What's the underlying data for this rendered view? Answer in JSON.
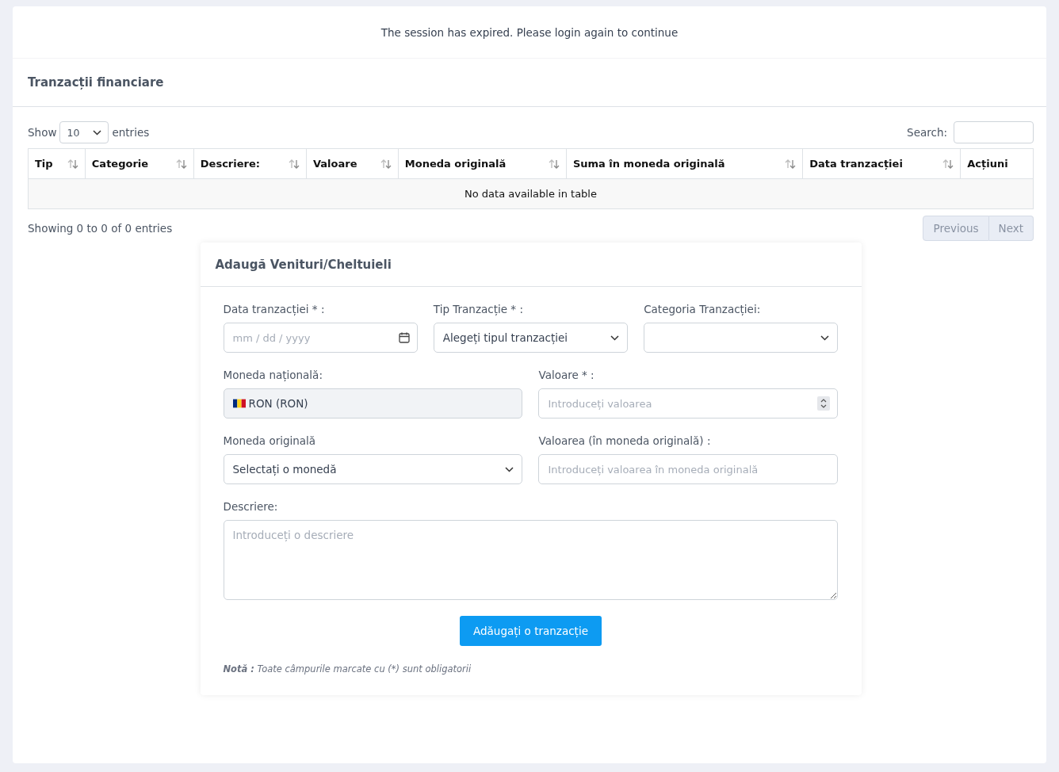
{
  "alert": {
    "text": "The session has expired. Please login again to continue"
  },
  "panel": {
    "title": "Tranzacții financiare"
  },
  "table_controls": {
    "show_label": "Show",
    "page_size": "10",
    "entries_label": "entries",
    "search_label": "Search:"
  },
  "table": {
    "columns": [
      {
        "label": "Tip",
        "sortable": true
      },
      {
        "label": "Categorie",
        "sortable": true
      },
      {
        "label": "Descriere:",
        "sortable": true
      },
      {
        "label": "Valoare",
        "sortable": true
      },
      {
        "label": "Moneda originală",
        "sortable": true
      },
      {
        "label": "Suma în moneda originală",
        "sortable": true
      },
      {
        "label": "Data tranzacției",
        "sortable": true
      },
      {
        "label": "Acțiuni",
        "sortable": false
      }
    ],
    "empty_message": "No data available in table"
  },
  "table_info": "Showing 0 to 0 of 0 entries",
  "pagination": [
    {
      "label": "Previous",
      "disabled": true
    },
    {
      "label": "Next",
      "disabled": true
    }
  ],
  "form": {
    "title": "Adaugă Venituri/Cheltuieli",
    "fields": [
      {
        "kind": "date",
        "label": "Data tranzacției * :",
        "placeholder": "mm / dd / yyyy"
      },
      {
        "kind": "select",
        "label": "Tip Tranzacție * :",
        "value": "Alegeți tipul tranzacției"
      },
      {
        "kind": "select",
        "label": "Categoria Tranzacției:"
      },
      {
        "kind": "readonly",
        "label": "Moneda națională:",
        "value": "RON (RON)"
      },
      {
        "kind": "number",
        "label": "Valoare * :",
        "placeholder": "Introduceți valoarea"
      },
      {
        "kind": "select",
        "label": "Moneda originală",
        "value": "Selectați o monedă"
      },
      {
        "kind": "text",
        "label": "Valoarea (în moneda originală) :",
        "placeholder": "Introduceți valoarea în moneda originală"
      },
      {
        "kind": "textarea",
        "label": "Descriere:",
        "placeholder": "Introduceți o descriere"
      }
    ],
    "submit": "Adăugați o tranzacție",
    "note": "**Notă :** Toate câmpurile marcate cu (*) sunt obligatorii"
  }
}
